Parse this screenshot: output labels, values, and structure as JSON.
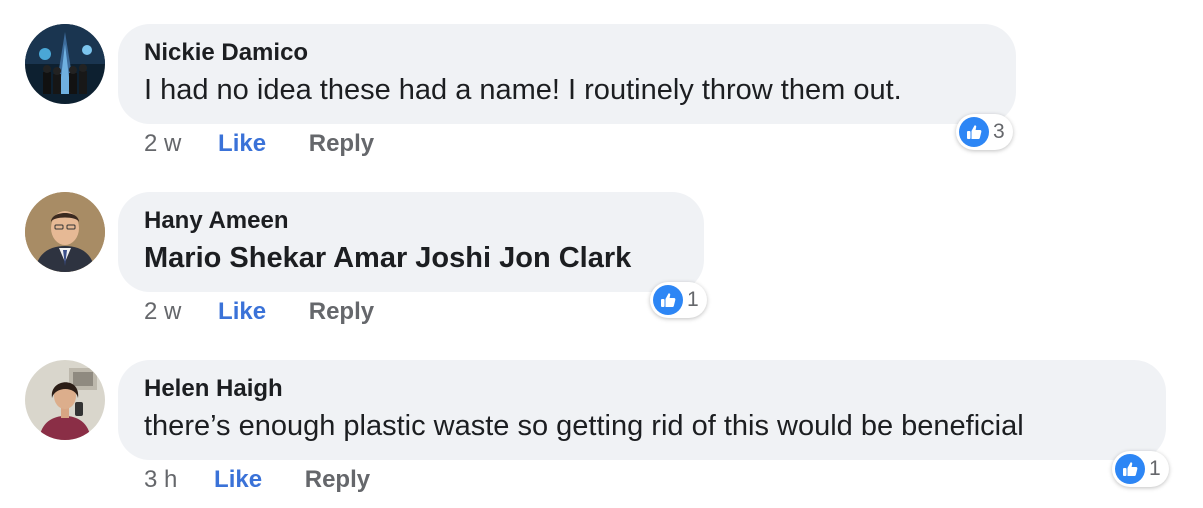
{
  "comments": [
    {
      "author": "Nickie Damico",
      "text": "I had no idea these had a name! I routinely throw them out.",
      "time": "2 w",
      "like_label": "Like",
      "reply_label": "Reply",
      "reaction_count": "3",
      "reaction_icon": "thumbs-up-icon"
    },
    {
      "author": "Hany Ameen",
      "text": "Mario Shekar Amar Joshi  Jon Clark",
      "time": "2 w",
      "like_label": "Like",
      "reply_label": "Reply",
      "reaction_count": "1",
      "reaction_icon": "thumbs-up-icon"
    },
    {
      "author": "Helen Haigh",
      "text": "there’s enough plastic waste so getting rid of this would be beneficial",
      "time": "3 h",
      "like_label": "Like",
      "reply_label": "Reply",
      "reaction_count": "1",
      "reaction_icon": "thumbs-up-icon"
    }
  ],
  "colors": {
    "bubble_bg": "#f0f2f5",
    "like_blue": "#3a72d8",
    "reaction_blue": "#2d86f5",
    "secondary_text": "#65676b"
  }
}
